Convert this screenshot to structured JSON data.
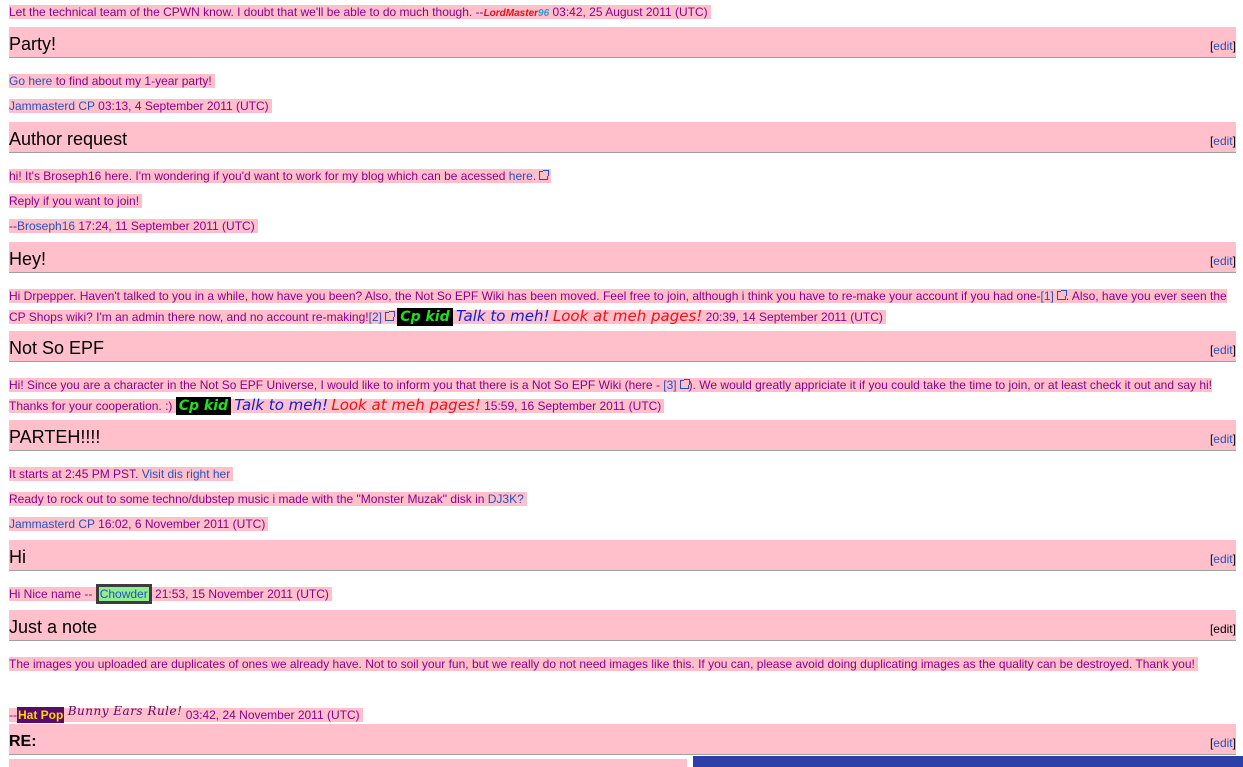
{
  "top": {
    "text": "Let the technical team of the CPWN know. I doubt that we'll be able to do much though. --",
    "sig_a": "LordMaster",
    "sig_b": "96",
    "time": " 03:42, 25 August 2011 (UTC)"
  },
  "edit_label": "edit",
  "sections": {
    "party": {
      "title": "Party!",
      "link": "Go here",
      "text": " to find about my 1-year party!",
      "user": "Jammasterd CP",
      "time": " 03:13, 4 September 2011 (UTC)"
    },
    "author": {
      "title": "Author request",
      "text": "hi! It's Broseph16 here. I'm wondering if you'd want to work for my blog which can be acessed ",
      "link": "here.",
      "reply": "Reply if you want to join!",
      "sig_prefix": "--",
      "user": "Broseph16",
      "time": " 17:24, 11 September 2011 (UTC)"
    },
    "hey": {
      "title": "Hey!",
      "text1": "Hi Drpepper. Haven't talked to you in a while, how have you been? Also, the Not So EPF Wiki has been moved. Feel free to join, although i think you have to re-make your account if you had one-",
      "ref1": "[1]",
      "text2": ". Also, have you ever seen the CP Shops wiki? I'm an admin there now, and no account re-making!",
      "ref2": "[2]",
      "cp_kid": "Cp kid",
      "talk": "Talk to meh!",
      "look": "Look at meh pages!",
      "time": " 20:39, 14 September 2011 (UTC)"
    },
    "notsoepf": {
      "title": "Not So EPF",
      "text1": "Hi! Since you are a character in the Not So EPF Universe, I would like to inform you that there is a Not So EPF Wiki (here - ",
      "ref": "[3]",
      "text2": "). We would greatly appriciate it if you could take the time to join, or at least check it out and say hi! Thanks for your cooperation. :) ",
      "cp_kid": "Cp kid",
      "talk": "Talk to meh!",
      "look": "Look at meh pages!",
      "time": " 15:59, 16 September 2011 (UTC)"
    },
    "parteh": {
      "title": "PARTEH!!!!",
      "text1": "It starts at 2:45 PM PST. ",
      "link1": "Visit dis right her",
      "text2": "Ready to rock out to some techno/dubstep music i made with the \"Monster Muzak\" disk in ",
      "link2": "DJ3K?",
      "user": "Jammasterd CP",
      "time": " 16:02, 6 November 2011 (UTC)"
    },
    "hi": {
      "title": "Hi",
      "text": "Hi Nice name -- ",
      "user": "Chowder",
      "time": " 21:53, 15 November 2011 (UTC)"
    },
    "note": {
      "title": "Just a note",
      "text": "The images you uploaded are duplicates of ones we already have. Not to soil your fun, but we really do not need images like this. If you can, please avoid doing duplicating images as the quality can be destroyed. Thank you!",
      "sig_prefix": "--",
      "user": "Hat Pop",
      "bunny": "Bunny Ears Rule!",
      "time": " 03:42, 24 November 2011 (UTC)"
    },
    "re": {
      "title": "RE:"
    }
  },
  "colors": {
    "highlight": "#ffc0cb",
    "text": "#8b008b",
    "link": "#2850b8"
  }
}
